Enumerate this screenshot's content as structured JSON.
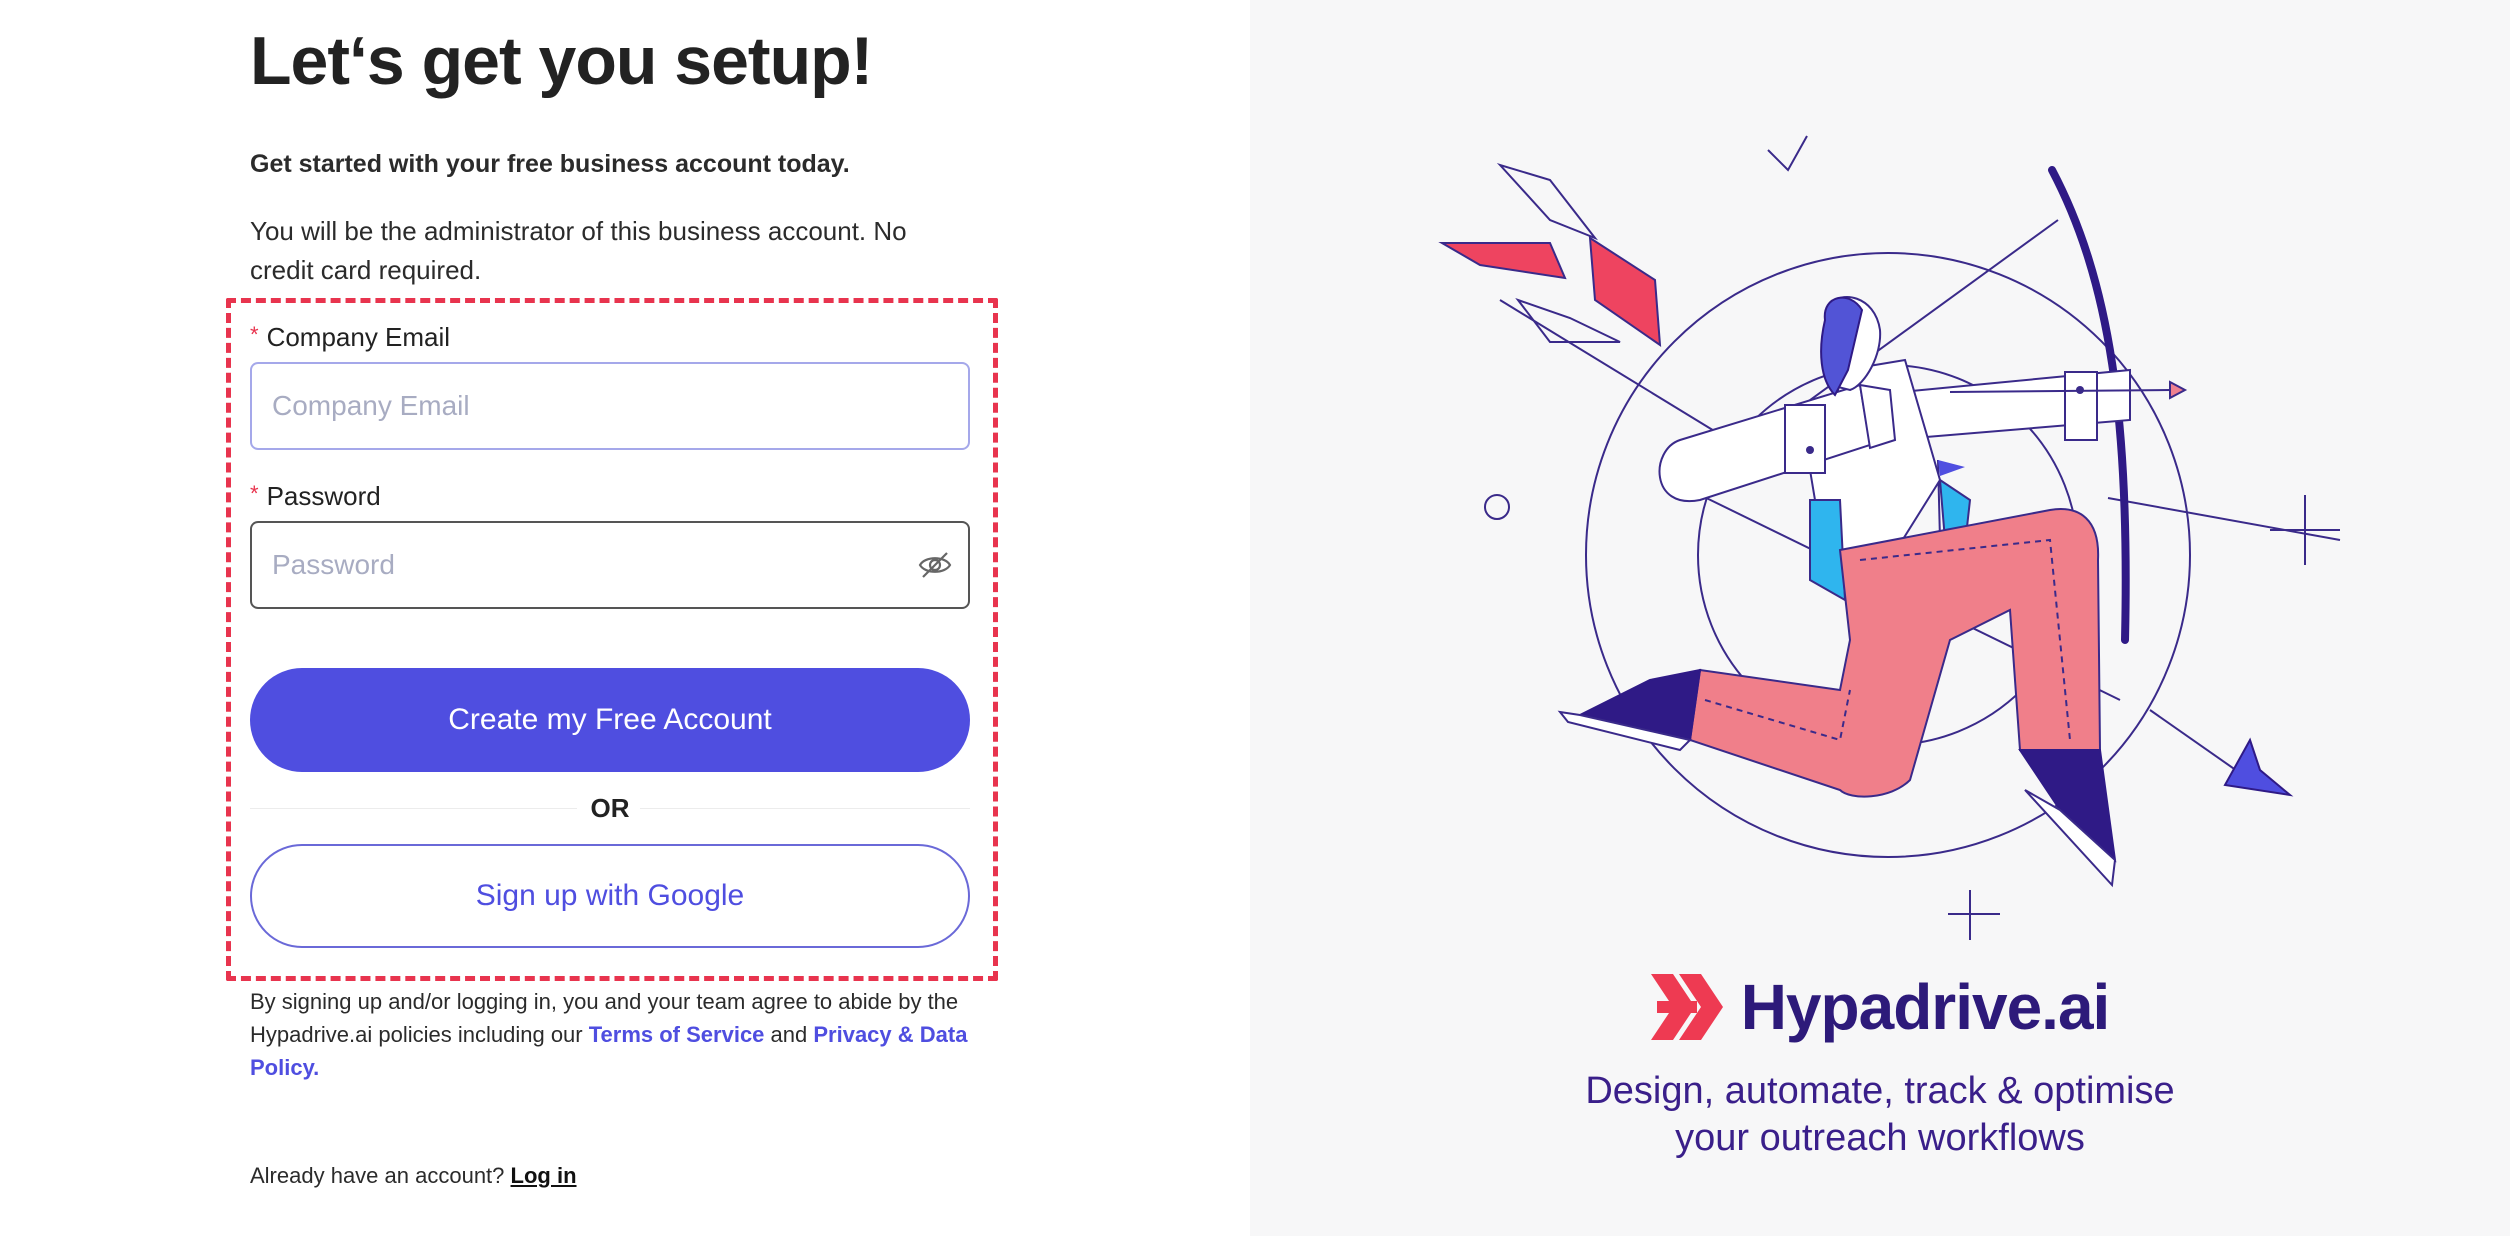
{
  "signup": {
    "title": "Let‘s get you setup!",
    "subtitle": "Get started with your free business account today.",
    "description": "You will be the administrator of this business account. No credit card required.",
    "email": {
      "label": "Company Email",
      "placeholder": "Company Email",
      "required_mark": "*"
    },
    "password": {
      "label": "Password",
      "placeholder": "Password",
      "required_mark": "*",
      "toggle_icon": "eye-slash-icon"
    },
    "create_button": "Create my Free Account",
    "divider": "OR",
    "google_button": "Sign up with Google",
    "legal": {
      "prefix": "By signing up and/or logging in, you and your team agree to abide by the Hypadrive.ai policies including our ",
      "terms_link": "Terms of Service",
      "middle": " and ",
      "privacy_link": "Privacy & Data Policy.",
      "suffix": ""
    },
    "login_prompt": "Already have an account?",
    "login_link": "Log in"
  },
  "brand": {
    "name": "Hypadrive.ai",
    "logo_icon": "double-chevron-logo-icon",
    "tagline_line1": "Design, automate, track & optimise",
    "tagline_line2": "your outreach workflows"
  },
  "colors": {
    "primary": "#4f4ee0",
    "required": "#e8344e",
    "highlight": "#e8344e",
    "brand_text": "#2d1a7a",
    "right_bg": "#f7f7f8"
  }
}
